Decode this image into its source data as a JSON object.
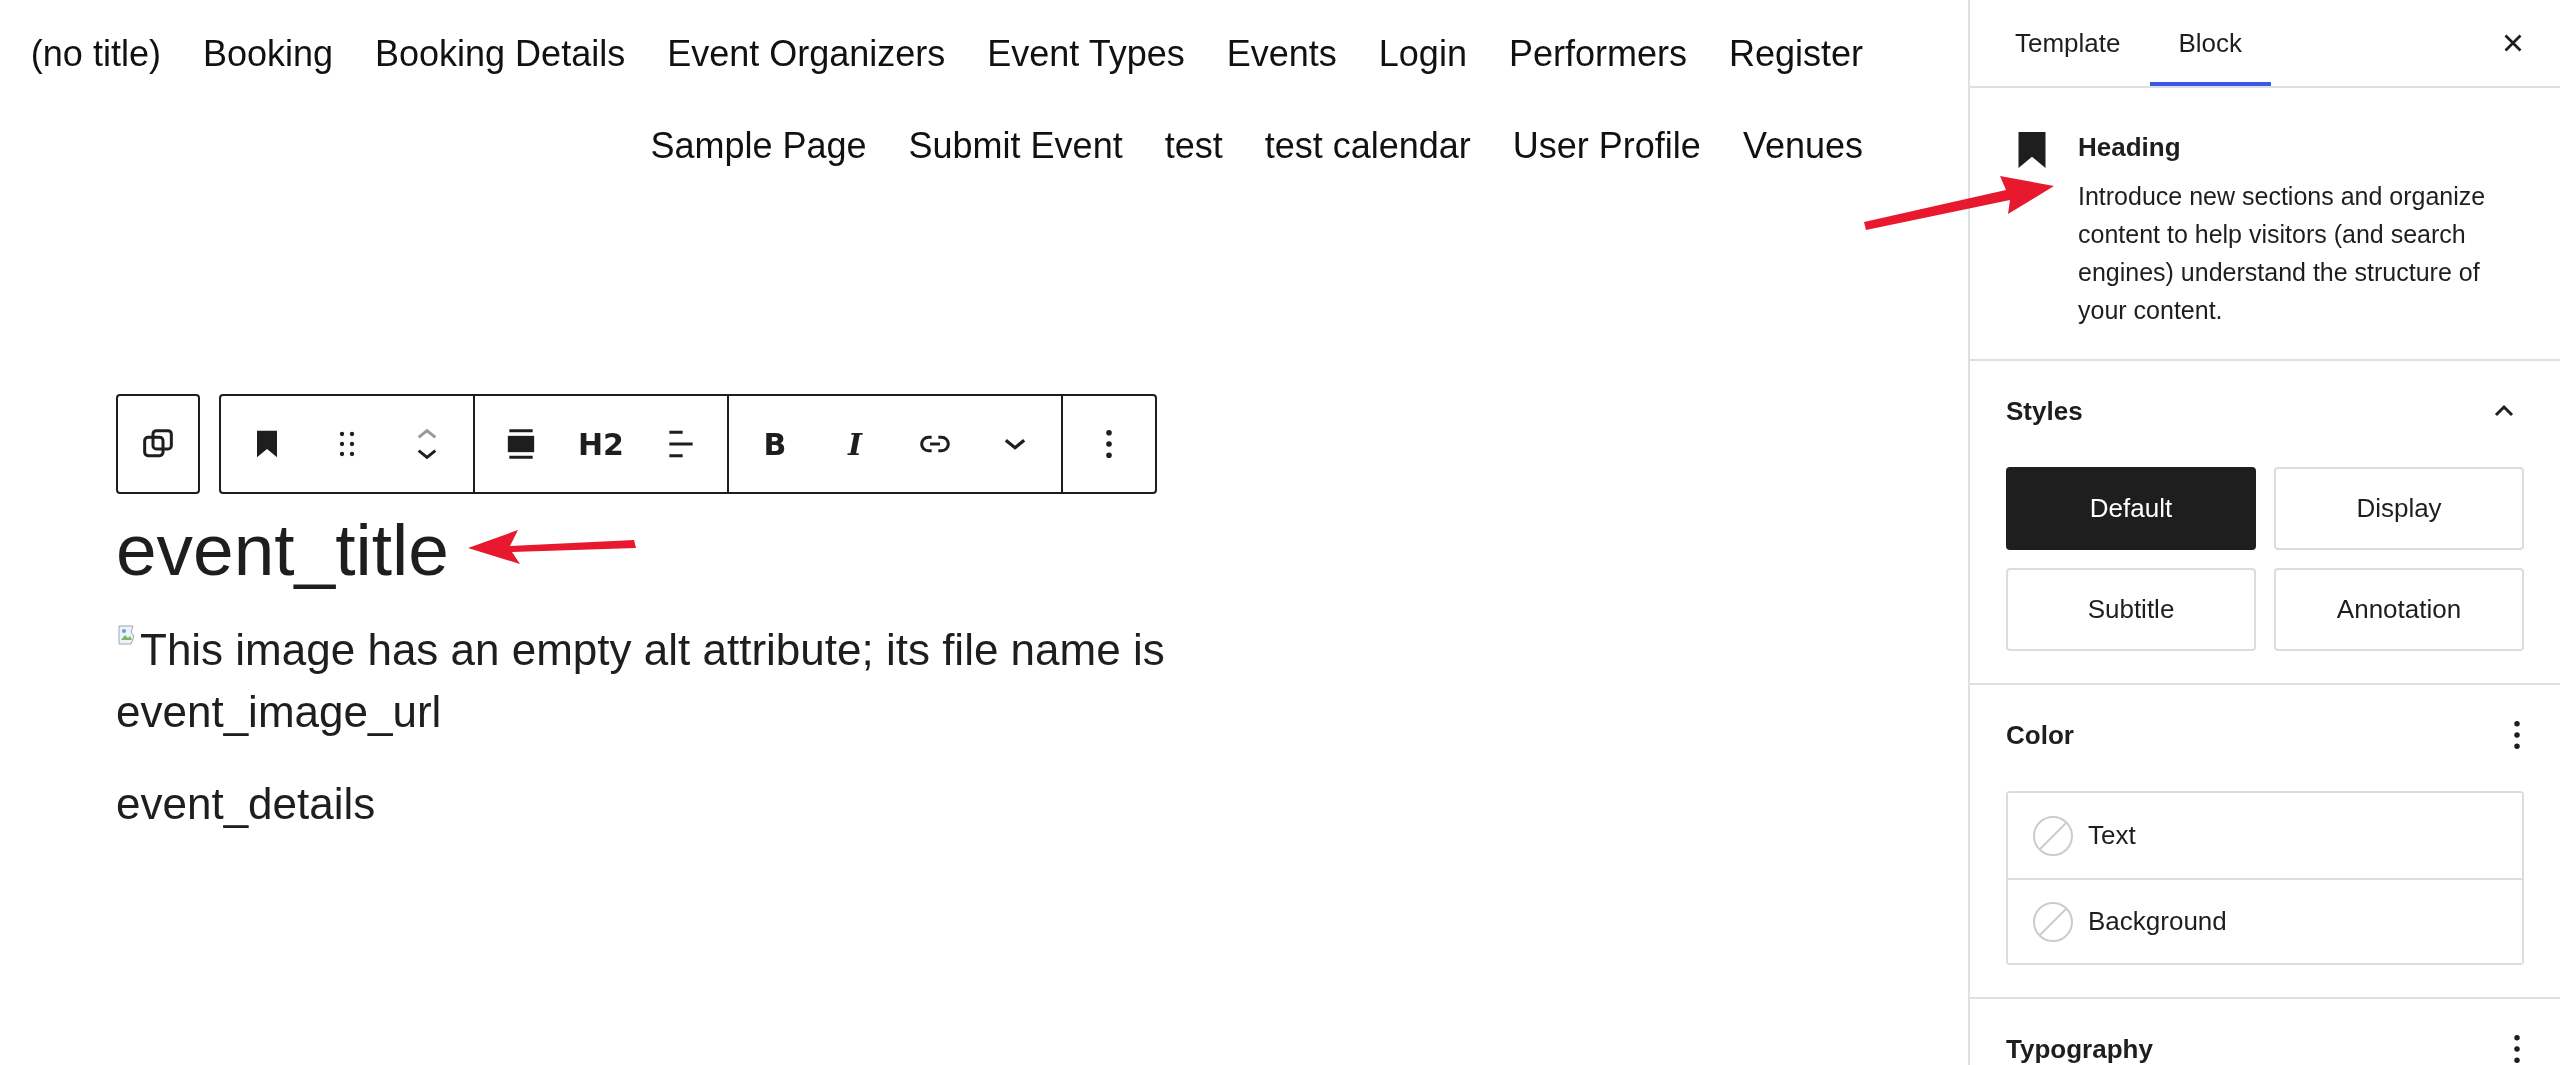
{
  "nav_rows": [
    {
      "items": [
        "(no title)",
        "Booking",
        "Booking Details",
        "Event Organizers",
        "Event Types",
        "Events",
        "Login",
        "Performers",
        "Register"
      ]
    },
    {
      "items": [
        "Sample Page",
        "Submit Event",
        "test",
        "test calendar",
        "User Profile",
        "Venues"
      ]
    }
  ],
  "toolbar": {
    "groups": [
      {
        "items": [
          {
            "kind": "copy"
          }
        ]
      },
      {
        "items": [
          {
            "kind": "bookmark"
          },
          {
            "kind": "drag"
          },
          {
            "kind": "move"
          }
        ]
      },
      {
        "items": [
          {
            "kind": "align"
          },
          {
            "kind": "label",
            "label": "H2"
          },
          {
            "kind": "text-align"
          }
        ]
      },
      {
        "items": [
          {
            "kind": "bold",
            "label": "B"
          },
          {
            "kind": "italic",
            "label": "I"
          },
          {
            "kind": "link"
          },
          {
            "kind": "more"
          }
        ]
      },
      {
        "items": [
          {
            "kind": "options"
          }
        ]
      }
    ]
  },
  "content": {
    "heading": "event_title",
    "image_alt": "This image has an empty alt attribute; its file name is event_image_url",
    "paragraph": "event_details"
  },
  "sidebar": {
    "tabs": [
      {
        "label": "Template",
        "selected": false
      },
      {
        "label": "Block",
        "selected": true
      }
    ],
    "block_card": {
      "title": "Heading",
      "description": "Introduce new sections and organize content to help visitors (and search engines) understand the structure of your content."
    },
    "styles": {
      "title": "Styles",
      "expanded": true,
      "options": [
        {
          "label": "Default",
          "selected": true
        },
        {
          "label": "Display",
          "selected": false
        },
        {
          "label": "Subtitle",
          "selected": false
        },
        {
          "label": "Annotation",
          "selected": false
        }
      ]
    },
    "color": {
      "title": "Color",
      "items": [
        {
          "label": "Text"
        },
        {
          "label": "Background"
        }
      ]
    },
    "typography": {
      "title": "Typography"
    }
  }
}
